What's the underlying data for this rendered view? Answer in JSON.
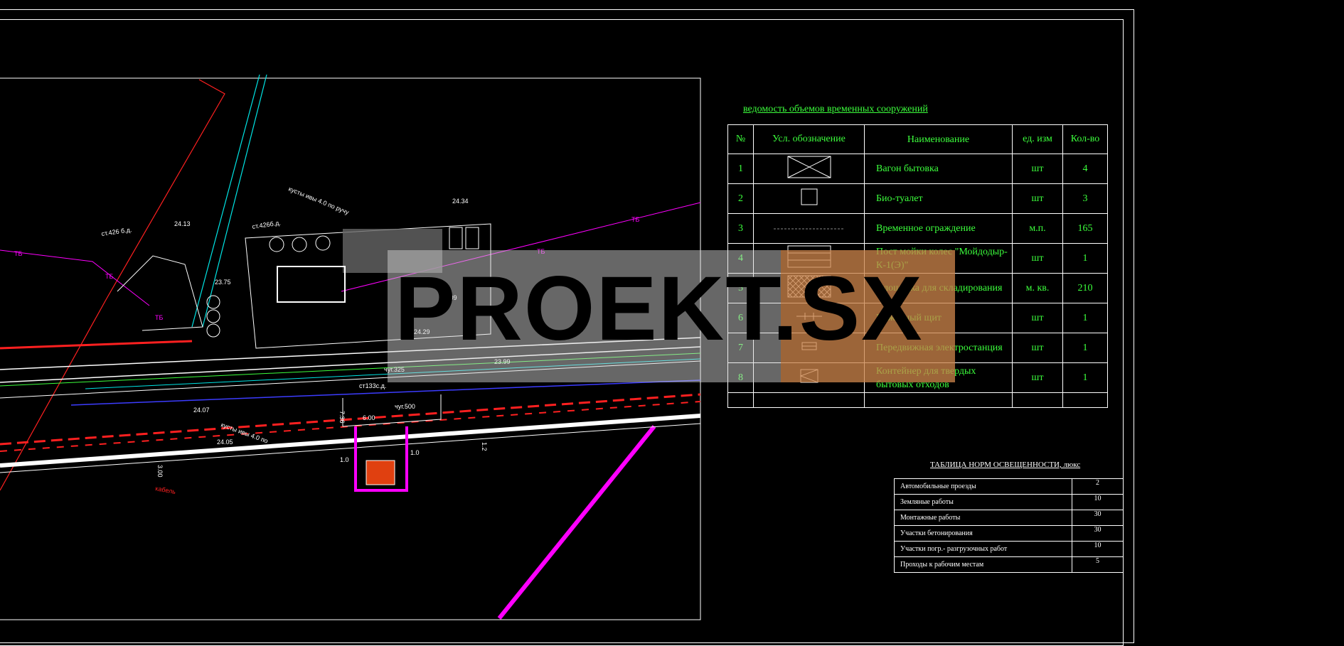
{
  "volumes_table": {
    "title": "ведомость объемов  временных сооружений",
    "headers": {
      "no": "№",
      "symbol": "Усл. обозначение",
      "name": "Наименование",
      "unit": "ед. изм",
      "qty": "Кол-во"
    },
    "rows": [
      {
        "no": "1",
        "symbol": "wagon-icon",
        "name": "Вагон бытовка",
        "unit": "шт",
        "qty": "4"
      },
      {
        "no": "2",
        "symbol": "bio-toilet-icon",
        "name": "Био-туалет",
        "unit": "шт",
        "qty": "3"
      },
      {
        "no": "3",
        "symbol": "fence-icon",
        "name": "Временное ограждение",
        "unit": "м.п.",
        "qty": "165"
      },
      {
        "no": "4",
        "symbol": "wheel-wash-icon",
        "name": "Пост мойки колес \"Мойдодыр-К-1(Э)\"",
        "unit": "шт",
        "qty": "1"
      },
      {
        "no": "5",
        "symbol": "storage-area-icon",
        "name": "Площадка для складирования",
        "unit": "м. кв.",
        "qty": "210"
      },
      {
        "no": "6",
        "symbol": "fire-board-icon",
        "name": "Пожарный щит",
        "unit": "шт",
        "qty": "1"
      },
      {
        "no": "7",
        "symbol": "power-station-icon",
        "name": "Передвижная электростанция",
        "unit": "шт",
        "qty": "1"
      },
      {
        "no": "8",
        "symbol": "waste-container-icon",
        "name": "Контейнер для твердых бытовых отходов",
        "unit": "шт",
        "qty": "1"
      }
    ]
  },
  "lighting_table": {
    "title": "ТАБЛИЦА НОРМ ОСВЕЩЕННОСТИ, люкс",
    "rows": [
      {
        "name": "Автомобильные проезды",
        "value": "2"
      },
      {
        "name": "Земляные работы",
        "value": "10"
      },
      {
        "name": "Монтажные работы",
        "value": "30"
      },
      {
        "name": "Участки бетонирования",
        "value": "30"
      },
      {
        "name": "Участки погр.- разгрузочных работ",
        "value": "10"
      },
      {
        "name": "Проходы к рабочим местам",
        "value": "5"
      }
    ]
  },
  "plan_labels": {
    "shrubs_top": "кусты ивы 4.0  по  ручу",
    "shrubs_bottom": "кусты ивы 4.0  по",
    "st426a": "ст.426  б.д.",
    "st426b": "ст.426б.д.",
    "st133": "ст133с.д.",
    "chug325": "чуг.325",
    "chug500": "чуг.500",
    "ts1": "ТБ",
    "ts2": "ТБ",
    "ts3": "ТБ",
    "ts4": "ТБ",
    "ts5": "ТБ",
    "dim1": "6.00",
    "dim2": "7.36",
    "dim3": "3.00",
    "dim4": "1.0",
    "dim5": "1.0",
    "dim6": "1.2",
    "el1": "24.13",
    "el2": "24.34",
    "el3": "24.09",
    "el4": "24.07",
    "el5": "23.99",
    "el6": "23.75",
    "el7": "24.29",
    "el8": "24.05",
    "cable": "кабель"
  },
  "watermark": "PROEKT.SX",
  "colors": {
    "background": "#000000",
    "table_text": "#3cff3c",
    "lines": "#ffffff",
    "road_red": "#ff2020",
    "magenta": "#ff00ff",
    "cyan": "#00e5e5"
  }
}
